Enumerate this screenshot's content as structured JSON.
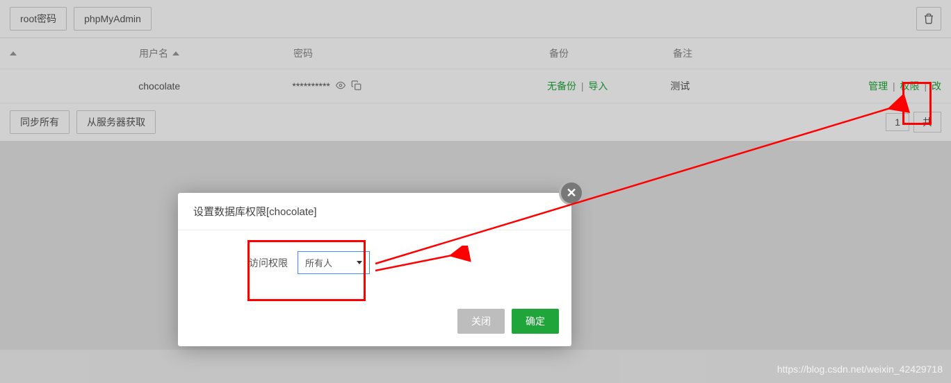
{
  "toolbar": {
    "root_pwd_btn": "root密码",
    "phpmyadmin_btn": "phpMyAdmin"
  },
  "table": {
    "headers": {
      "username": "用户名",
      "password": "密码",
      "backup": "备份",
      "note": "备注"
    },
    "row": {
      "username": "chocolate",
      "password_mask": "**********",
      "backup_none": "无备份",
      "backup_import": "导入",
      "note": "测试",
      "action_manage": "管理",
      "action_permission": "权限",
      "action_change": "改"
    }
  },
  "footer": {
    "sync_all": "同步所有",
    "fetch_server": "从服务器获取",
    "page_num": "1",
    "total_prefix": "共"
  },
  "modal": {
    "title": "设置数据库权限[chocolate]",
    "access_label": "访问权限",
    "select_value": "所有人",
    "close_btn": "关闭",
    "confirm_btn": "确定"
  },
  "watermark": "https://blog.csdn.net/weixin_42429718"
}
